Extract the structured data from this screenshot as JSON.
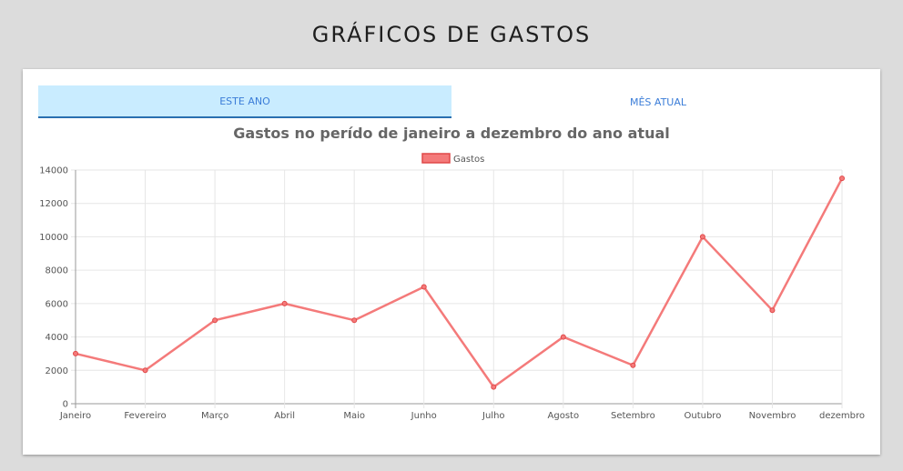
{
  "page": {
    "title": "GRÁFICOS DE GASTOS"
  },
  "tabs": [
    {
      "label": "ESTE ANO",
      "active": true
    },
    {
      "label": "MÊS ATUAL",
      "active": false
    }
  ],
  "colors": {
    "series": "#f47a7a",
    "active_tab_bg": "#c9ecff",
    "tab_text": "#3b7dd8"
  },
  "chart_data": {
    "type": "line",
    "title": "Gastos no perído de janeiro a dezembro do ano atual",
    "xlabel": "",
    "ylabel": "",
    "categories": [
      "Janeiro",
      "Fevereiro",
      "Março",
      "Abril",
      "Maio",
      "Junho",
      "Julho",
      "Agosto",
      "Setembro",
      "Outubro",
      "Novembro",
      "dezembro"
    ],
    "series": [
      {
        "name": "Gastos",
        "values": [
          3000,
          2000,
          5000,
          6000,
          5000,
          7000,
          1000,
          4000,
          2300,
          10000,
          5600,
          13500
        ]
      }
    ],
    "ylim": [
      0,
      14000
    ],
    "yticks": [
      0,
      2000,
      4000,
      6000,
      8000,
      10000,
      12000,
      14000
    ],
    "grid": true,
    "legend": "top-center"
  }
}
